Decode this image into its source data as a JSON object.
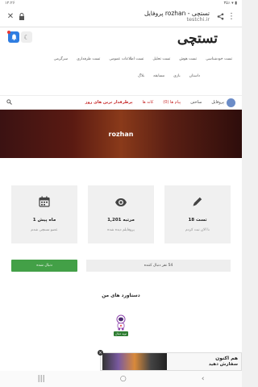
{
  "status": {
    "time": "۱۲:۲۶",
    "right": "۳۵٪ ▾ ▮"
  },
  "browser": {
    "title": "پروفایل rozhan - تستچی",
    "host": "testchi.ir"
  },
  "header": {
    "logo": "تستچی",
    "menu_row1": [
      "تست خودشناسی",
      "تست هوش",
      "تست تحلیل",
      "تست اطلاعات عمومی",
      "تست طرفداری",
      "سرگرمی"
    ],
    "menu_row2": [
      "داستان",
      "بازی",
      "مسابقه",
      "بلاگ"
    ]
  },
  "nav": {
    "profile": "پروفایل",
    "create": "ساختن",
    "messages": "پیام ها (0)",
    "clubs": "کانه ها",
    "popular": "پرطرفدار ترین های روز"
  },
  "profile": {
    "name": "rozhan"
  },
  "stats": [
    {
      "icon": "pencil-icon",
      "value": "18 تست",
      "label": "تا الان ثبت کردم"
    },
    {
      "icon": "eye-icon",
      "value": "1,201 مرتبه",
      "label": "پروفایلم دیده شده"
    },
    {
      "icon": "calendar-icon",
      "value": "1 ماه پیش",
      "label": "عضو تستچی شدم"
    }
  ],
  "follow": {
    "count_text": "54 نفر دنبال کننده",
    "button": "دنبال شده"
  },
  "achievements": {
    "title": "دستاورد های من",
    "badge_label": "نوپه دنبال"
  },
  "ad": {
    "line1": "هم اکنون",
    "line2": "سفارش دهید"
  },
  "colors": {
    "accent_green": "#43a047",
    "accent_red": "#c62828",
    "bell_blue": "#2f7de1"
  }
}
